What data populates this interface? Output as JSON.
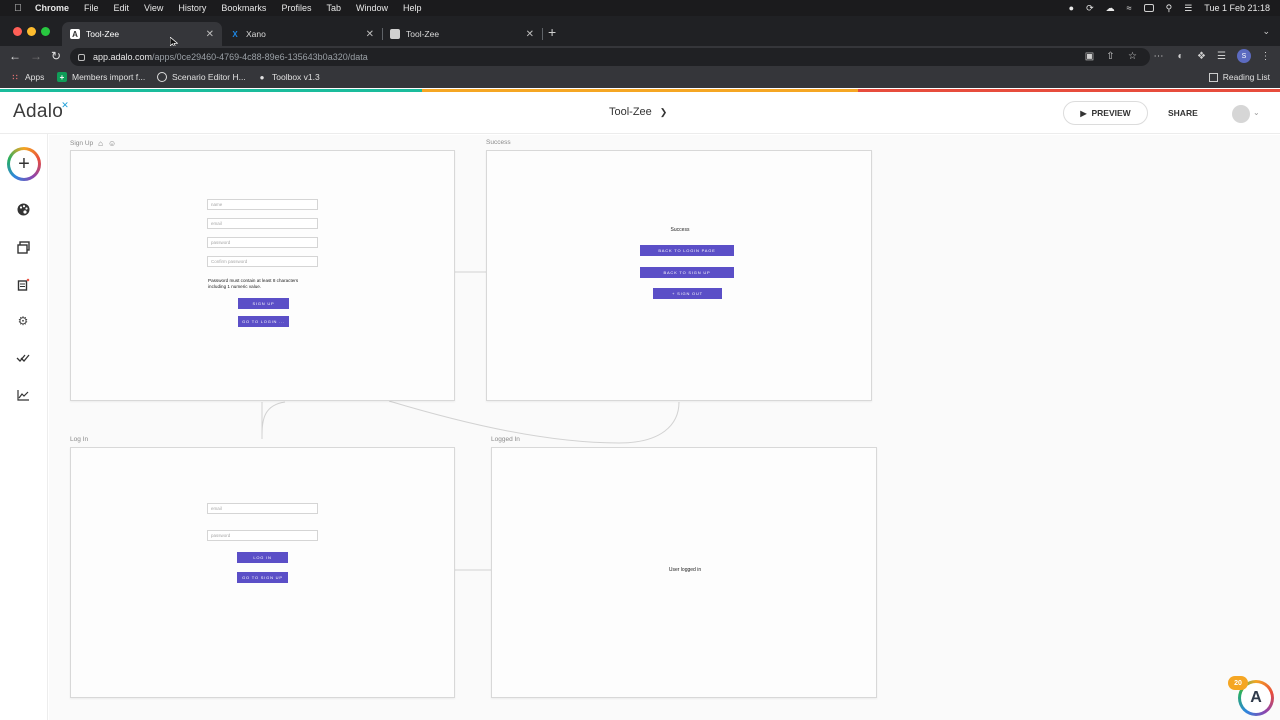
{
  "menubar": {
    "items": [
      "Chrome",
      "File",
      "Edit",
      "View",
      "History",
      "Bookmarks",
      "Profiles",
      "Tab",
      "Window",
      "Help"
    ],
    "datetime": "Tue 1 Feb  21:18"
  },
  "tabs": [
    {
      "label": "Tool-Zee",
      "icon": "adalo-favicon"
    },
    {
      "label": "Xano",
      "icon": "xano-favicon"
    },
    {
      "label": "Tool-Zee",
      "icon": "blank-favicon"
    }
  ],
  "address": {
    "host": "app.adalo.com",
    "path": "/apps/0ce29460-4769-4c88-89e6-135643b0a320/data"
  },
  "bookmarks": [
    {
      "label": "Apps",
      "icon": "apps-grid-icon"
    },
    {
      "label": "Members import f...",
      "icon": "sheets-icon"
    },
    {
      "label": "Scenario Editor H...",
      "icon": "loader-icon"
    },
    {
      "label": "Toolbox v1.3",
      "icon": "globe-icon"
    }
  ],
  "reading_list": "Reading List",
  "header": {
    "logo": "Adalo",
    "app_name": "Tool-Zee",
    "preview_label": "PREVIEW",
    "share_label": "SHARE"
  },
  "screens": {
    "signup": {
      "label": "Sign Up",
      "fields": [
        "name",
        "email",
        "password",
        "Confirm password"
      ],
      "hint_line1": "Password must contain at least 8 characters",
      "hint_line2": "including 1 numeric value.",
      "buttons": [
        "SIGN UP",
        "GO TO LOGIN ..."
      ]
    },
    "success": {
      "label": "Success",
      "title": "Success",
      "buttons": [
        "BACK TO LOGIN PAGE",
        "BACK TO SIGN UP",
        "SIGN OUT"
      ]
    },
    "login": {
      "label": "Log In",
      "fields": [
        "email",
        "password"
      ],
      "buttons": [
        "LOG IN",
        "GO TO SIGN UP"
      ]
    },
    "loggedin": {
      "label": "Logged In",
      "text": "User logged in"
    }
  },
  "notifications_badge": "20",
  "colors": {
    "button": "#5b4fc7",
    "accent_rainbow": [
      "#1abc9c",
      "#f5a623",
      "#e74c3c"
    ]
  }
}
